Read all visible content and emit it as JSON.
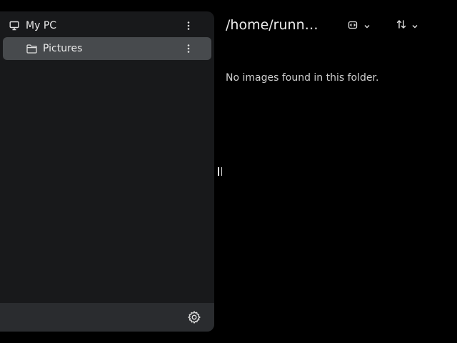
{
  "sidebar": {
    "items": [
      {
        "label": "My PC",
        "icon": "monitor-icon",
        "selected": false
      },
      {
        "label": "Pictures",
        "icon": "folder-icon",
        "selected": true
      }
    ],
    "footer": {
      "settings_icon": "gear-icon"
    }
  },
  "main": {
    "path": "/home/runn…",
    "empty_message": "No images found in this folder.",
    "toolbar": {
      "view_icon": "view-mode-icon",
      "sort_icon": "sort-icon"
    }
  },
  "colors": {
    "background": "#000000",
    "sidebar": "#18191b",
    "selected_row": "#474a4d",
    "footer": "#2a2c2f",
    "text": "#eaeaea"
  }
}
